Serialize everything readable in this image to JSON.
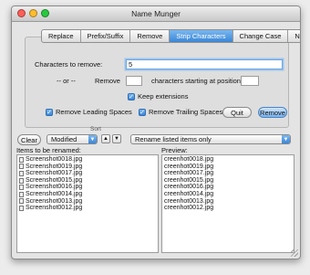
{
  "window": {
    "title": "Name Munger",
    "colors": {
      "close": "#ff5f57",
      "minimize": "#ffbd2e",
      "zoom": "#28c940",
      "accent": "#3b86d6"
    }
  },
  "tabs": [
    {
      "label": "Replace",
      "active": false
    },
    {
      "label": "Prefix/Suffix",
      "active": false
    },
    {
      "label": "Remove",
      "active": false
    },
    {
      "label": "Strip Characters",
      "active": true
    },
    {
      "label": "Change Case",
      "active": false
    },
    {
      "label": "Number",
      "active": false
    }
  ],
  "strip": {
    "chars_label": "Characters to remove:",
    "chars_value": "5",
    "or_label": "-- or --",
    "remove_label": "Remove",
    "remove_count": "",
    "starting_label": "characters starting at position",
    "position_value": "",
    "keep_extensions": {
      "label": "Keep extensions",
      "checked": true
    },
    "leading": {
      "label": "Remove Leading Spaces",
      "checked": true
    },
    "trailing": {
      "label": "Remove Trailing Spaces",
      "checked": true
    },
    "quit_label": "Quit",
    "remove_button": "Remove"
  },
  "controls": {
    "clear_label": "Clear",
    "sort_label": "Sort",
    "sort_value": "Modified",
    "sort_up": "▲",
    "sort_down": "▼",
    "rename_value": "Rename listed items only"
  },
  "items": {
    "header": "Items to be renamed:",
    "files": [
      "Screenshot0018.jpg",
      "Screenshot0019.jpg",
      "Screenshot0017.jpg",
      "Screenshot0015.jpg",
      "Screenshot0016.jpg",
      "Screenshot0014.jpg",
      "Screenshot0013.jpg",
      "Screenshot0012.jpg"
    ]
  },
  "preview": {
    "header": "Preview:",
    "files": [
      "creenhot0018.jpg",
      "creenhot0019.jpg",
      "creenhot0017.jpg",
      "creenhot0015.jpg",
      "creenhot0016.jpg",
      "creenhot0014.jpg",
      "creenhot0013.jpg",
      "creenhot0012.jpg"
    ]
  }
}
